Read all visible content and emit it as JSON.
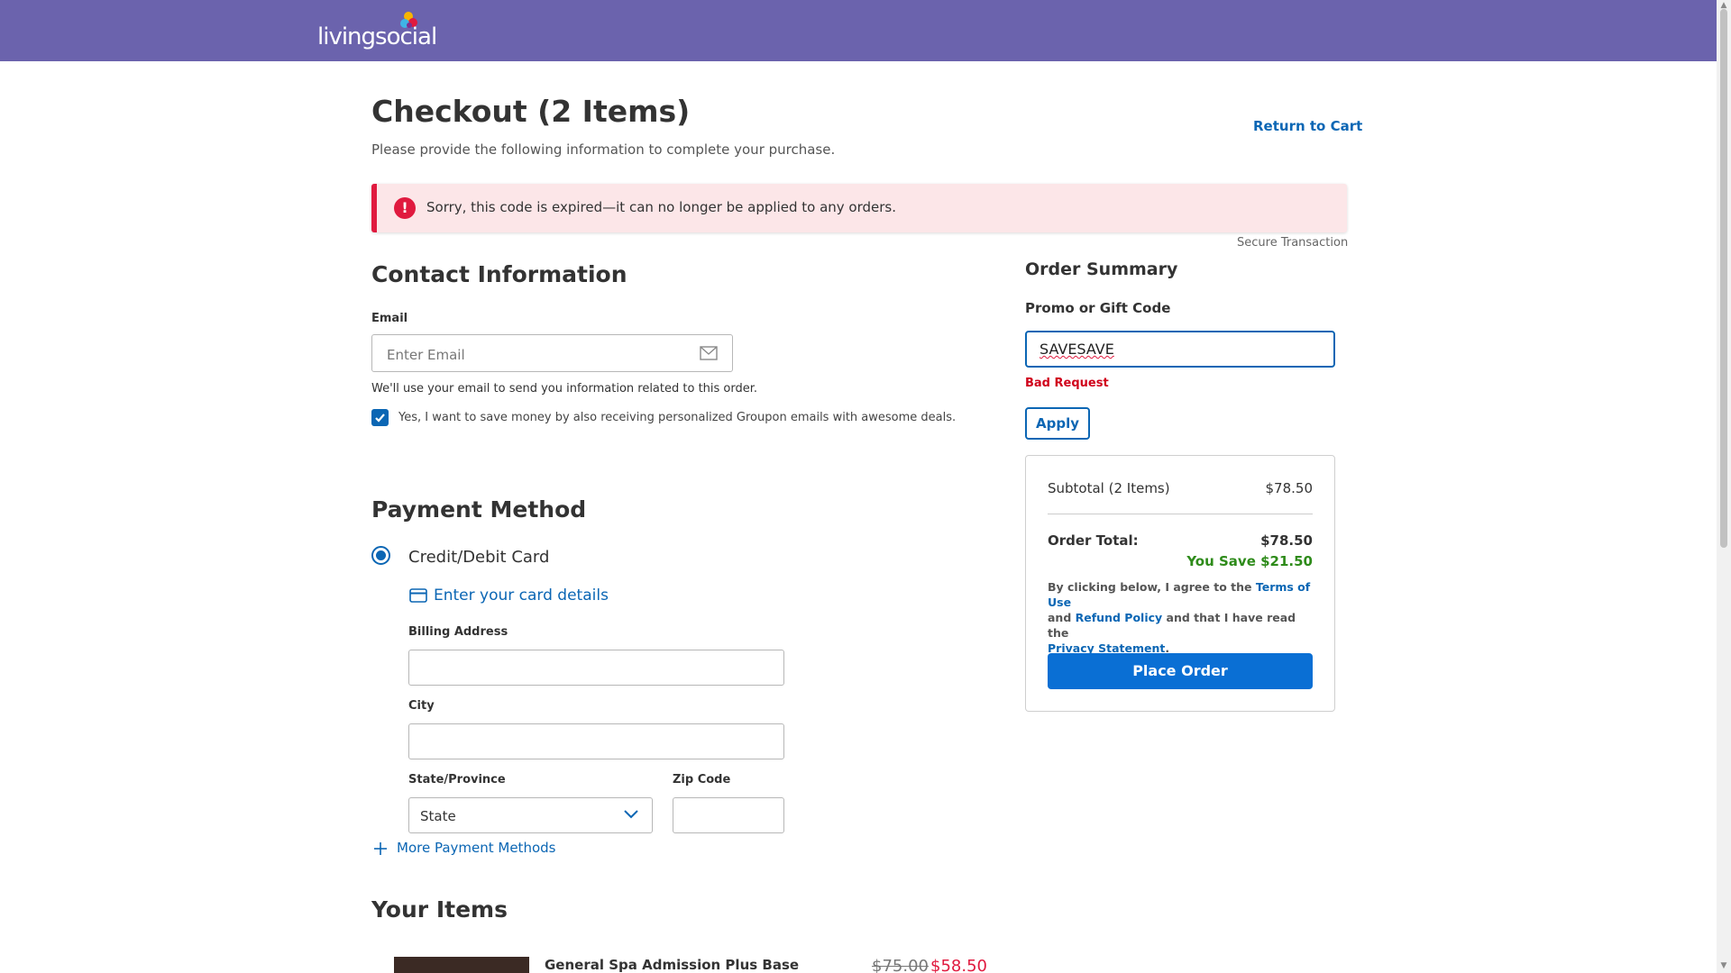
{
  "header": {
    "logo_text": "livingsocial",
    "logo_colors": [
      "#f7b500",
      "#e01a3f",
      "#3fb4e5",
      "#7b2f92"
    ],
    "bg_color": "#6b63ad"
  },
  "page": {
    "title": "Checkout (2 Items)",
    "subtitle": "Please provide the following information to complete your purchase.",
    "return_link": "Return to Cart"
  },
  "alert": {
    "icon": "exclamation-icon",
    "symbol": "!",
    "message": "Sorry, this code is expired—it can no longer be applied to any orders."
  },
  "secure_text": "Secure Transaction",
  "contact": {
    "heading": "Contact Information",
    "email_label": "Email",
    "email_placeholder": "Enter Email",
    "email_note": "We'll use your email to send you information related to this order.",
    "optin_checked": true,
    "optin_text": "Yes, I want to save money by also receiving personalized Groupon emails with awesome deals."
  },
  "payment": {
    "heading": "Payment Method",
    "option_label": "Credit/Debit Card",
    "option_selected": true,
    "card_link": "Enter your card details",
    "billing_label": "Billing Address",
    "billing_value": "",
    "city_label": "City",
    "city_value": "",
    "state_label": "State/Province",
    "state_value": "State",
    "zip_label": "Zip Code",
    "zip_value": "",
    "more_methods": "More Payment Methods"
  },
  "order_summary": {
    "heading": "Order Summary",
    "promo_label": "Promo or Gift Code",
    "promo_value": "SAVESAVE",
    "promo_error": "Bad Request",
    "apply_label": "Apply",
    "subtotal_label": "Subtotal (2 Items)",
    "subtotal_value": "$78.50",
    "total_label": "Order Total:",
    "total_value": "$78.50",
    "savings": "You Save $21.50",
    "terms_prefix": "By clicking below, I agree to the ",
    "terms_link": "Terms of Use",
    "terms_and": " and ",
    "refund_link": "Refund Policy",
    "terms_mid": " and that I have read the ",
    "privacy_link": "Privacy Statement",
    "terms_end": ".",
    "place_order": "Place Order"
  },
  "items": {
    "heading": "Your Items",
    "list": [
      {
        "title": "General Spa Admission Plus Base",
        "original_price": "$75.00",
        "price": "$58.50"
      }
    ]
  },
  "colors": {
    "accent": "#0b66b4",
    "button": "#0a6fd4",
    "error": "#e01a3f",
    "success": "#2e8b1a"
  }
}
